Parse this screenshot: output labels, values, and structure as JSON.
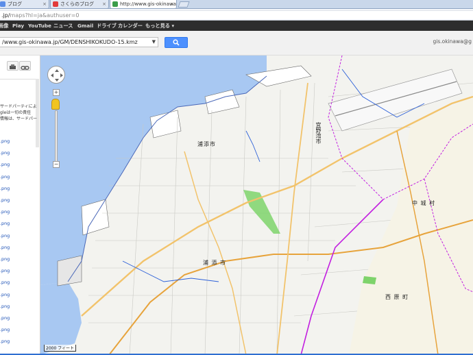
{
  "browser": {
    "tabs": [
      {
        "label": "ブログ"
      },
      {
        "label": "さくらのブログ"
      },
      {
        "label": "http://www.gis-okinawa.jp"
      }
    ],
    "url_prefix": ".jp/",
    "url_rest": "maps?hl=ja&authuser=0"
  },
  "gbar": {
    "items": [
      "画像",
      "Play",
      "YouTube",
      "ニュース",
      "Gmail",
      "ドライブ",
      "カレンダー",
      "もっと見る ▾"
    ]
  },
  "search": {
    "value": "/www.gis-okinawa.jp/GM/DENSHIKOKUDO-15.kmz",
    "button_icon": "search-icon",
    "user": "gis.okinawa@g"
  },
  "leftpanel": {
    "note_lines": [
      "サードパーティによ",
      "gleは一切の責任",
      "情報は、サードパー"
    ],
    "files": [
      ".png",
      ".png",
      ".png",
      ".png",
      ".png",
      ".png",
      ".png",
      ".png",
      ".png",
      ".png",
      ".png",
      ".png",
      ".png",
      ".png",
      ".png",
      ".png",
      ".png",
      ".png"
    ]
  },
  "map": {
    "labels": {
      "urasoe_north": "浦添市",
      "urasoe_center": "浦 添 市",
      "ginowan": "宜野湾市",
      "nakagusuku": "中 城 村",
      "nishihara": "西 原 町"
    },
    "zoom_in": "+",
    "zoom_out": "−",
    "scale": "2000 フィート"
  },
  "colors": {
    "sea": "#a8c8f2",
    "map_bg": "#f3f3ef",
    "road_major": "#f2c36b",
    "road_primary": "#e7a33b",
    "boundary": "#c21ee0",
    "park": "#7ed36b",
    "river": "#2b5fd8"
  }
}
